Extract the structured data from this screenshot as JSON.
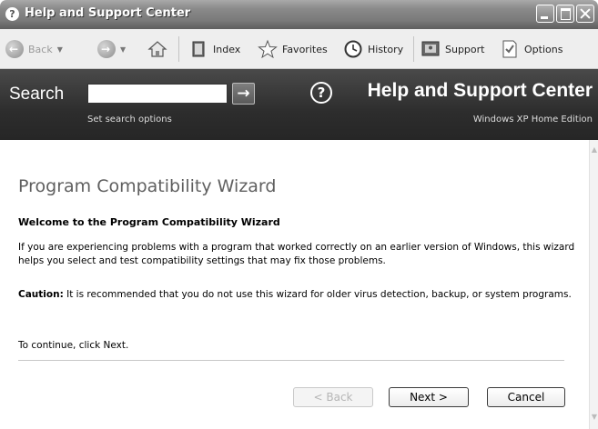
{
  "window": {
    "title": "Help and Support Center"
  },
  "toolbar": {
    "back_label": "Back",
    "index_label": "Index",
    "favorites_label": "Favorites",
    "history_label": "History",
    "support_label": "Support",
    "options_label": "Options"
  },
  "header": {
    "search_label": "Search",
    "search_value": "",
    "set_search_options": "Set search options",
    "app_title": "Help and Support Center",
    "edition": "Windows XP Home Edition"
  },
  "content": {
    "title": "Program Compatibility Wizard",
    "subhead": "Welcome to the Program Compatibility Wizard",
    "intro": "If you are experiencing problems with a program that worked correctly on an earlier version of Windows, this wizard helps you select and test compatibility settings that may fix those problems.",
    "caution_label": "Caution:",
    "caution_text": " It is recommended that you do not use this wizard for older virus detection, backup, or system programs.",
    "continue_text": "To continue, click Next."
  },
  "buttons": {
    "back": "< Back",
    "next": "Next >",
    "cancel": "Cancel"
  },
  "icons": {
    "back": "back-arrow-icon",
    "forward": "forward-arrow-icon",
    "home": "home-icon",
    "index": "index-book-icon",
    "favorites": "star-icon",
    "history": "history-clock-icon",
    "support": "support-icon",
    "options": "options-check-icon",
    "help": "help-question-icon"
  }
}
